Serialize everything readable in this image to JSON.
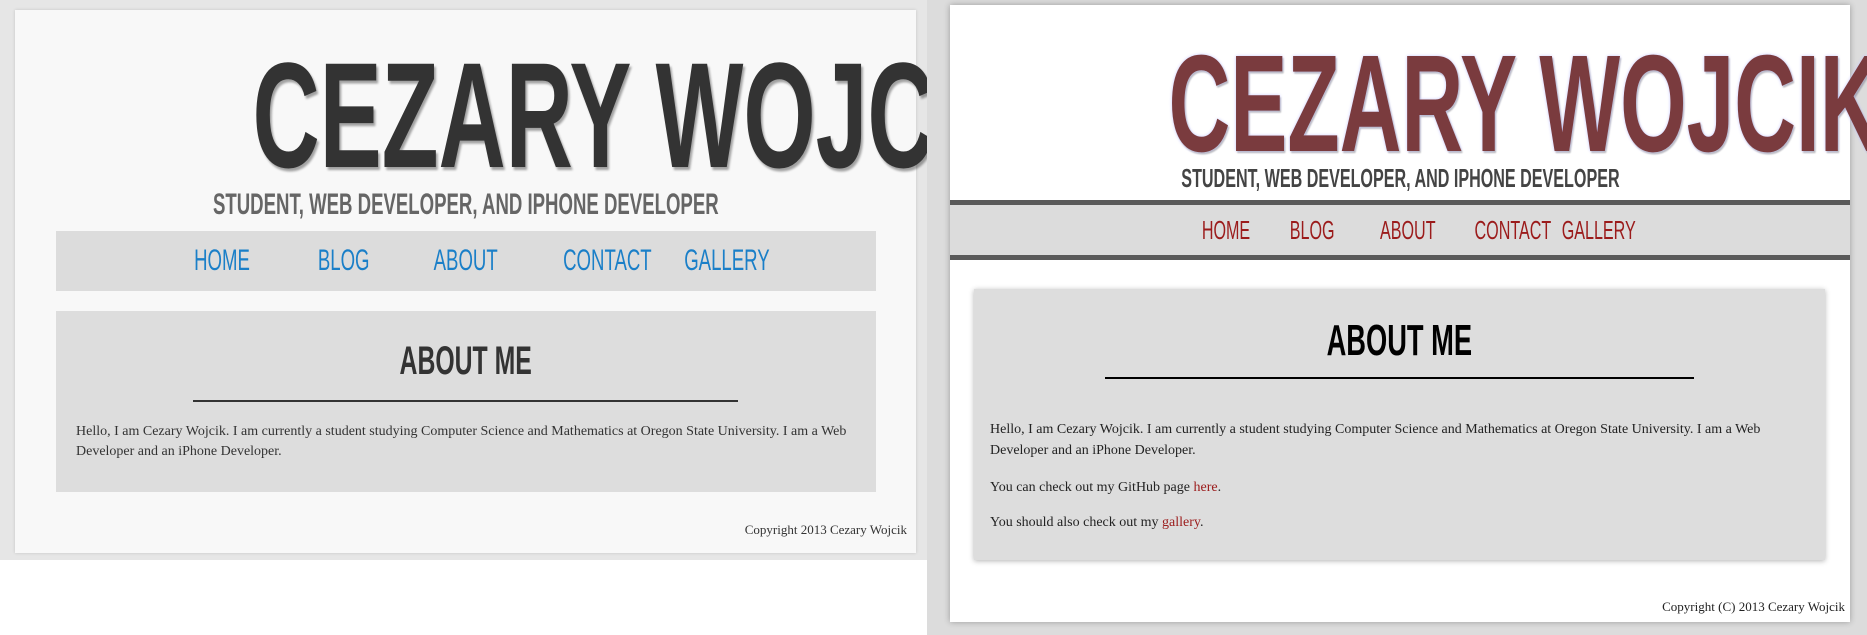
{
  "left": {
    "title": "CEZARY WOJCIK",
    "subtitle": "STUDENT, WEB DEVELOPER, AND IPHONE DEVELOPER",
    "nav": [
      "HOME",
      "BLOG",
      "ABOUT",
      "CONTACT",
      "GALLERY"
    ],
    "about_heading": "ABOUT ME",
    "about_text": "Hello, I am Cezary Wojcik. I am currently a student studying Computer Science and Mathematics at Oregon State University. I am a Web Developer and an iPhone Developer.",
    "copyright": "Copyright 2013 Cezary Wojcik",
    "colors": {
      "title": "#333333",
      "nav_link": "#1a7fc8",
      "panel": "#dddddd"
    }
  },
  "right": {
    "title": "CEZARY WOJCIK",
    "subtitle": "STUDENT, WEB DEVELOPER, AND IPHONE DEVELOPER",
    "nav": [
      "HOME",
      "BLOG",
      "ABOUT",
      "CONTACT",
      "GALLERY"
    ],
    "about_heading": "ABOUT ME",
    "about_text": "Hello, I am Cezary Wojcik. I am currently a student studying Computer Science and Mathematics at Oregon State University. I am a Web Developer and an iPhone Developer.",
    "github_prefix": "You can check out my GitHub page ",
    "github_link": "here",
    "github_suffix": ".",
    "gallery_prefix": "You should also check out my ",
    "gallery_link": "gallery",
    "gallery_suffix": ".",
    "copyright": "Copyright (C) 2013 Cezary Wojcik",
    "colors": {
      "title": "#7a3b3e",
      "nav_link": "#9b1b1b",
      "nav_border": "#5a5a5a"
    }
  }
}
